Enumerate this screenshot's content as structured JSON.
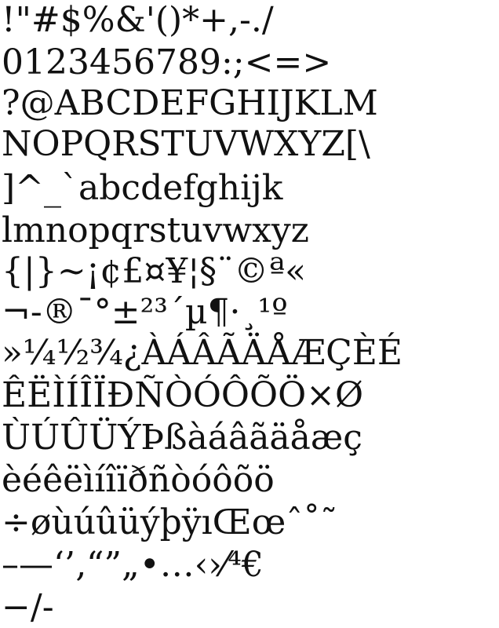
{
  "specimen": {
    "rows": [
      "!\"#$%&'()*+,-./",
      "0123456789:;<=>",
      "?@ABCDEFGHIJKLM",
      "NOPQRSTUVWXYZ[\\",
      "]^_`abcdefghijk",
      "lmnopqrstuvwxyz",
      "{|}~¡¢£¤¥¦§¨©ª«",
      "¬-®¯°±²³´µ¶·¸¹º",
      "»¼½¾¿ÀÁÂÃÄÅÆÇÈÉ",
      "ÊËÌÍÎÏÐÑÒÓÔÕÖ×Ø",
      "ÙÚÛÜÝÞßàáâãäåæç",
      "èéêëìíîïðñòóôõö",
      "÷øùúûüýþÿıŒœˆ˚˜",
      "–—‘’‚“”„•…‹›⁄⁴€",
      "−∕-"
    ]
  },
  "colors": {
    "background": "#ffffff",
    "glyph": "#111111"
  }
}
